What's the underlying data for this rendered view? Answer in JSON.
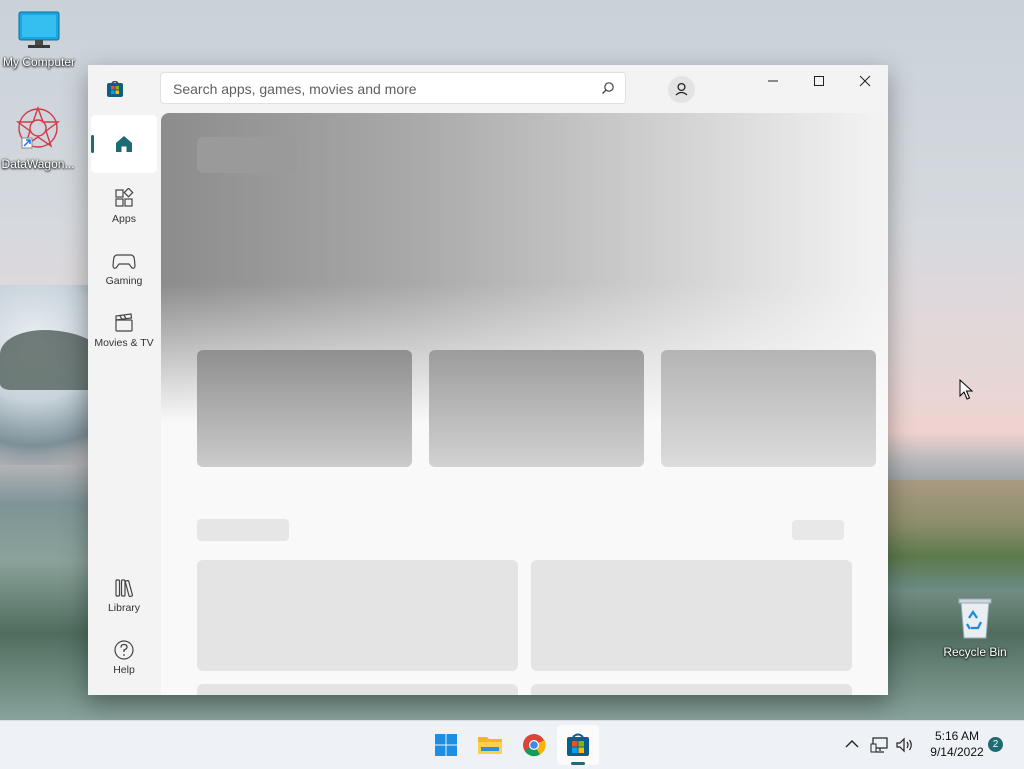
{
  "desktop": {
    "icons": [
      {
        "label": "My Computer"
      },
      {
        "label": "DataWagon..."
      },
      {
        "label": "Recycle Bin"
      }
    ]
  },
  "window": {
    "search_placeholder": "Search apps, games, movies and more",
    "nav": [
      {
        "label": "",
        "icon": "home-icon",
        "active": true
      },
      {
        "label": "Apps",
        "icon": "apps-icon"
      },
      {
        "label": "Gaming",
        "icon": "controller-icon"
      },
      {
        "label": "Movies & TV",
        "icon": "clapperboard-icon"
      },
      {
        "label": "Library",
        "icon": "library-icon"
      },
      {
        "label": "Help",
        "icon": "help-icon"
      }
    ],
    "accent": "#1f6b73"
  },
  "taskbar": {
    "apps": [
      "start-icon",
      "file-explorer-icon",
      "chrome-icon",
      "store-icon"
    ],
    "clock_time": "5:16 AM",
    "clock_date": "9/14/2022",
    "notification_count": "2"
  }
}
